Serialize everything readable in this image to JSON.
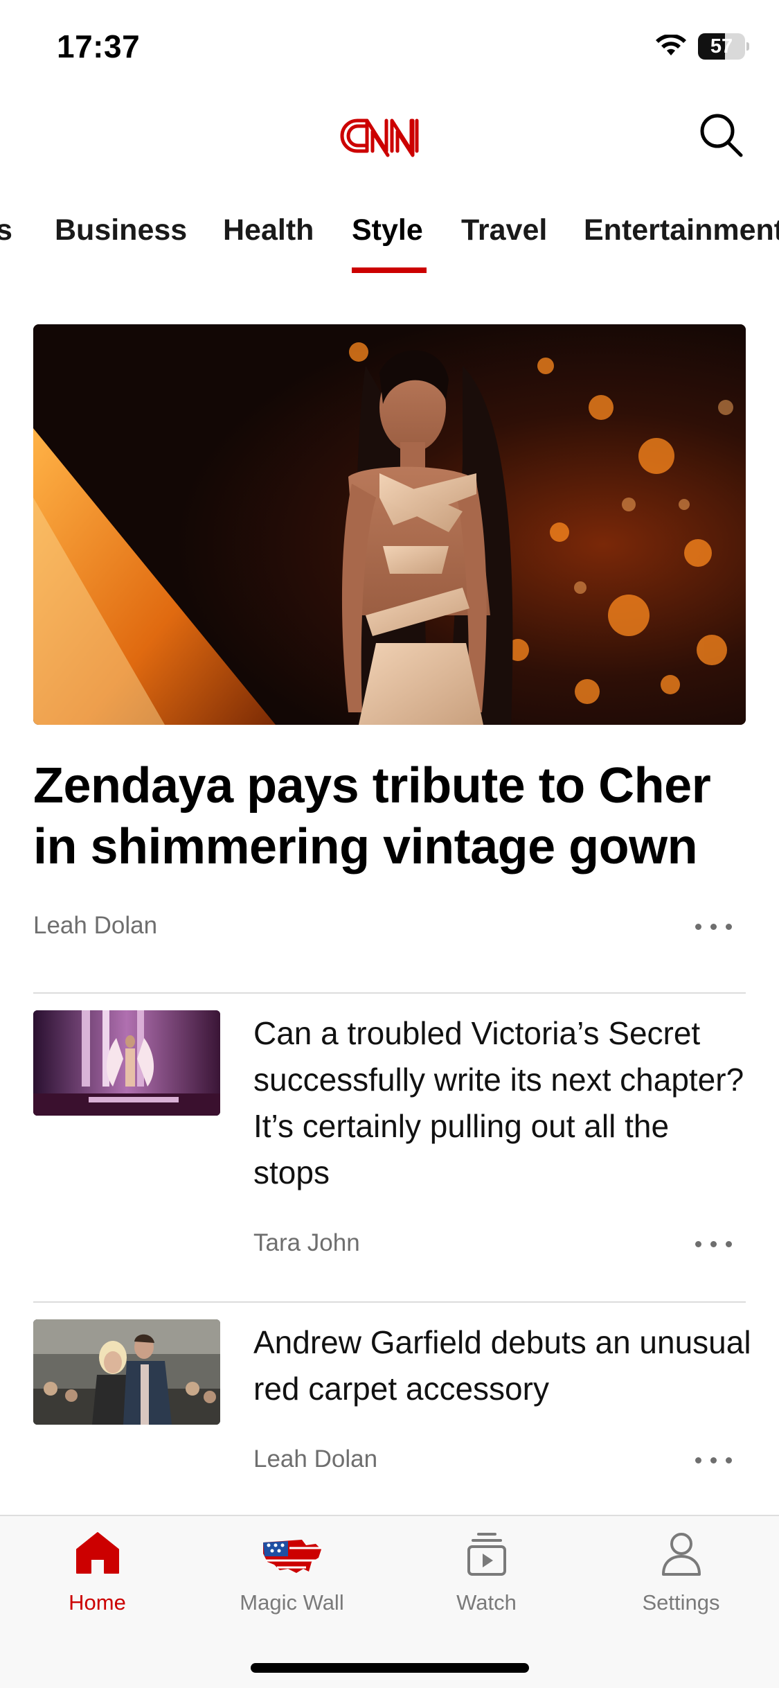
{
  "status_bar": {
    "time": "17:37",
    "battery_level": "57",
    "battery_fraction": 0.57
  },
  "header": {
    "logo_text": "CNN",
    "brand_color": "#cc0000",
    "search_icon": "search-icon"
  },
  "section_tabs": {
    "items": [
      "s",
      "Business",
      "Health",
      "Style",
      "Travel",
      "Entertainment"
    ],
    "active": "Style"
  },
  "hero_story": {
    "headline": "Zendaya pays tribute to Cher in shimmering vintage gown",
    "byline": "Leah Dolan"
  },
  "stories": [
    {
      "headline": "Can a troubled Victoria’s Secret successfully write its next chapter? It’s certainly pulling out all the stops",
      "byline": "Tara John"
    },
    {
      "headline": "Andrew Garfield debuts an unusual red carpet accessory",
      "byline": "Leah Dolan"
    }
  ],
  "tab_bar": {
    "items": [
      {
        "label": "Home",
        "icon": "home-icon",
        "active": true
      },
      {
        "label": "Magic Wall",
        "icon": "us-flag-map-icon",
        "active": false
      },
      {
        "label": "Watch",
        "icon": "watch-play-icon",
        "active": false
      },
      {
        "label": "Settings",
        "icon": "person-icon",
        "active": false
      }
    ],
    "active_color": "#cc0000"
  }
}
